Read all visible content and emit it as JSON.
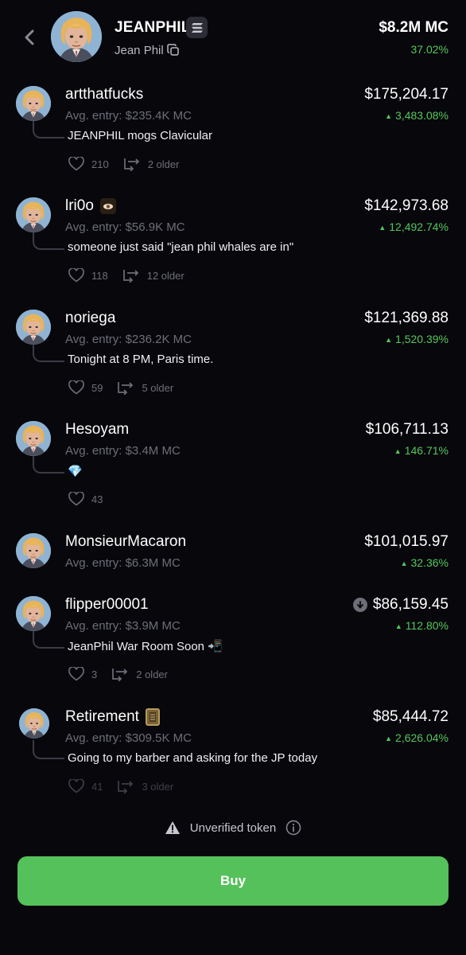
{
  "header": {
    "token_name": "JEANPHIL",
    "token_subname": "Jean Phil",
    "market_cap": "$8.2M MC",
    "change": "37.02%",
    "icons": {
      "back": "back-chevron-icon",
      "chain": "chain-badge-icon",
      "copy": "copy-icon"
    }
  },
  "holders": [
    {
      "name": "artthatfucks",
      "entry": "Avg. entry: $235.4K MC",
      "message": "JEANPHIL mogs Clavicular",
      "value": "$175,204.17",
      "change": "3,483.08%",
      "likes": "210",
      "older": "2 older"
    },
    {
      "name": "lri0o",
      "entry": "Avg. entry: $56.9K MC",
      "message": "someone just said \"jean phil whales are in\"",
      "value": "$142,973.68",
      "change": "12,492.74%",
      "likes": "118",
      "older": "12 older",
      "badge_icon": "eye-emoji-icon"
    },
    {
      "name": "noriega",
      "entry": "Avg. entry: $236.2K MC",
      "message": "Tonight at 8 PM, Paris time.",
      "value": "$121,369.88",
      "change": "1,520.39%",
      "likes": "59",
      "older": "5 older"
    },
    {
      "name": "Hesoyam",
      "entry": "Avg. entry: $3.4M MC",
      "message": "💎",
      "value": "$106,711.13",
      "change": "146.71%",
      "likes": "43"
    },
    {
      "name": "MonsieurMacaron",
      "entry": "Avg. entry: $6.3M MC",
      "value": "$101,015.97",
      "change": "32.36%"
    },
    {
      "name": "flipper00001",
      "entry": "Avg. entry: $3.9M MC",
      "message": "JeanPhil War Room Soon 📲",
      "value": "$86,159.45",
      "change": "112.80%",
      "likes": "3",
      "older": "2 older",
      "status_icon": "download-circle-icon"
    },
    {
      "name": "Retirement",
      "entry": "Avg. entry: $309.5K MC",
      "message": "Going to my barber and asking for the JP today",
      "value": "$85,444.72",
      "change": "2,626.04%",
      "likes": "41",
      "older": "3 older",
      "badge_icon": "calendar-emoji-icon"
    }
  ],
  "footer": {
    "warning": "Unverified token",
    "buy_label": "Buy",
    "accent_color": "#55c15a",
    "positive_color": "#54c75a"
  }
}
